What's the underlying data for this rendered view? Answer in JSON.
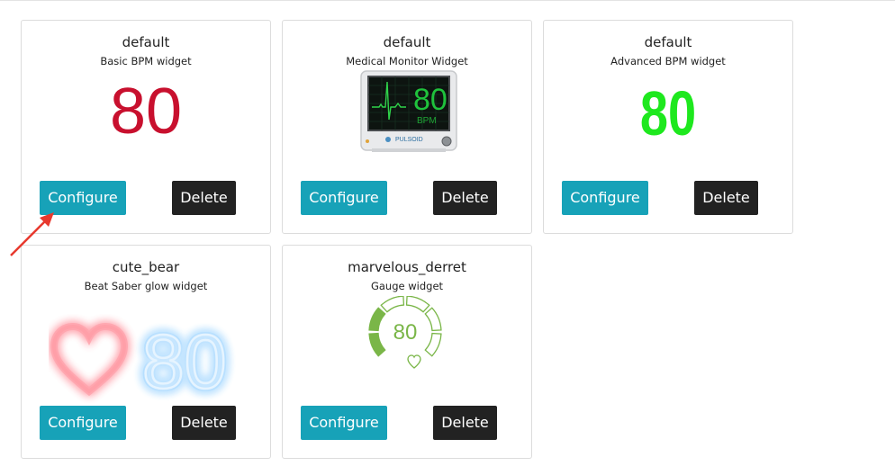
{
  "widgets": [
    {
      "name": "default",
      "type": "Basic BPM widget",
      "value": "80"
    },
    {
      "name": "default",
      "type": "Medical Monitor Widget",
      "value": "80",
      "unit": "BPM",
      "brand": "PULSOID"
    },
    {
      "name": "default",
      "type": "Advanced BPM widget",
      "value": "80"
    },
    {
      "name": "cute_bear",
      "type": "Beat Saber glow widget",
      "value": "80"
    },
    {
      "name": "marvelous_derret",
      "type": "Gauge widget",
      "value": "80"
    }
  ],
  "buttons": {
    "configure": "Configure",
    "delete": "Delete"
  },
  "colors": {
    "accent": "#17a2b8",
    "dark": "#222222",
    "basic_red": "#c8102e",
    "advanced_green": "#1ee81e",
    "gauge_green": "#7ab648",
    "glow_red": "#ff4d5e",
    "glow_blue": "#3aa8ff"
  },
  "icons": {
    "annotation": "red-arrow-icon",
    "heart": "heart-icon"
  },
  "gauge": {
    "fraction": 0.4
  }
}
